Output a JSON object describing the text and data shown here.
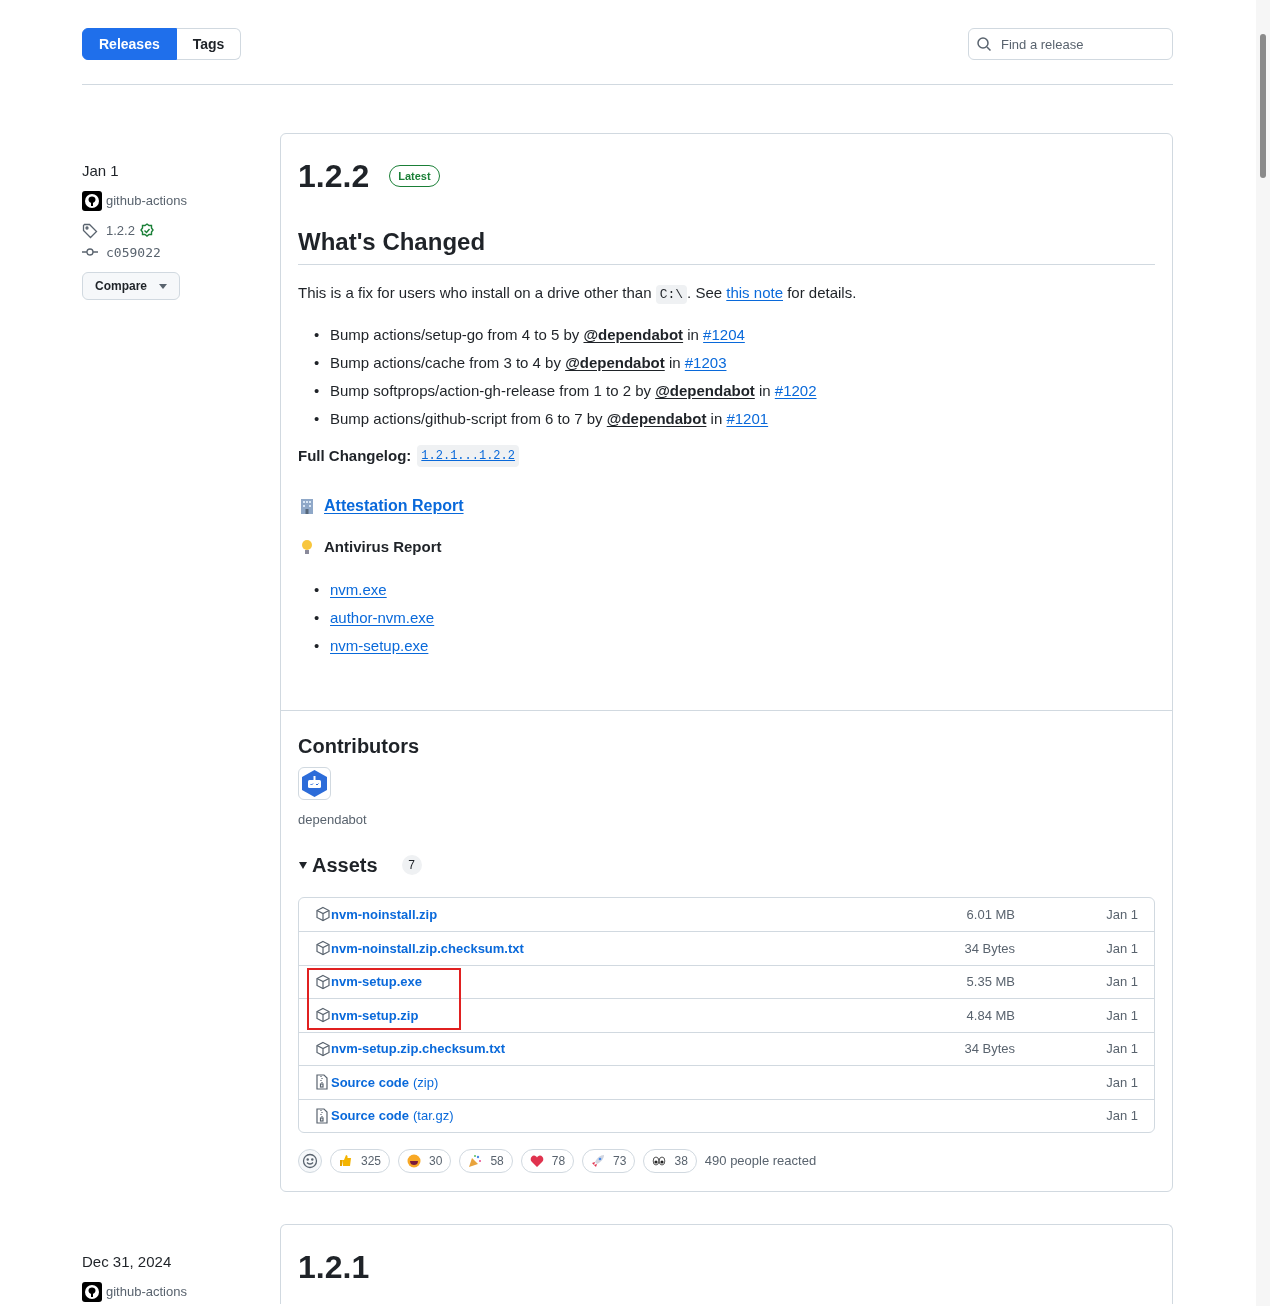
{
  "tabs": [
    {
      "label": "Releases",
      "selected": true
    },
    {
      "label": "Tags",
      "selected": false
    }
  ],
  "search": {
    "placeholder": "Find a release"
  },
  "releases": [
    {
      "date": "Jan 1",
      "author": "github-actions",
      "tag": "1.2.2",
      "verified": true,
      "commit": "c059022",
      "compare": "Compare",
      "title": "1.2.2",
      "latest": true,
      "latest_label": "Latest",
      "heading": "What's Changed",
      "intro": {
        "before": "This is a fix for users who install on a drive other than",
        "code": "C:\\",
        "middle": ". See",
        "link": "this note",
        "after": "for details."
      },
      "changes": [
        {
          "marker": "•",
          "text": "Bump actions/setup-go from 4 to 5 by",
          "user": "@dependabot",
          "in": "in",
          "pr": "#1204"
        },
        {
          "marker": "•",
          "text": "Bump actions/cache from 3 to 4 by",
          "user": "@dependabot",
          "in": "in",
          "pr": "#1203"
        },
        {
          "marker": "•",
          "text": "Bump softprops/action-gh-release from 1 to 2 by",
          "user": "@dependabot",
          "in": "in",
          "pr": "#1202"
        },
        {
          "marker": "•",
          "text": "Bump actions/github-script from 6 to 7 by",
          "user": "@dependabot",
          "in": "in",
          "pr": "#1201"
        }
      ],
      "changelog": {
        "label": "Full Changelog:",
        "link": "1.2.1...1.2.2"
      },
      "attestation": "Attestation Report",
      "antivirus": "Antivirus Report",
      "antivirus_links": [
        {
          "marker": "•",
          "text": "nvm.exe"
        },
        {
          "marker": "•",
          "text": "author-nvm.exe"
        },
        {
          "marker": "•",
          "text": "nvm-setup.exe"
        }
      ],
      "contributors_heading": "Contributors",
      "contributors": [
        "dependabot"
      ],
      "assets_heading": "Assets",
      "assets_count": "7",
      "assets_expanded": true,
      "assets": [
        {
          "kind": "file",
          "name": "nvm-noinstall.zip",
          "size": "6.01 MB",
          "date": "Jan 1",
          "marked": false
        },
        {
          "kind": "file",
          "name": "nvm-noinstall.zip.checksum.txt",
          "size": "34 Bytes",
          "date": "Jan 1",
          "marked": false
        },
        {
          "kind": "file",
          "name": "nvm-setup.exe",
          "size": "5.35 MB",
          "date": "Jan 1",
          "marked": true
        },
        {
          "kind": "file",
          "name": "nvm-setup.zip",
          "size": "4.84 MB",
          "date": "Jan 1",
          "marked": true
        },
        {
          "kind": "file",
          "name": "nvm-setup.zip.checksum.txt",
          "size": "34 Bytes",
          "date": "Jan 1",
          "marked": false
        },
        {
          "kind": "source",
          "name": "Source code",
          "format": "(zip)",
          "date": "Jan 1",
          "marked": false
        },
        {
          "kind": "source",
          "name": "Source code",
          "format": "(tar.gz)",
          "date": "Jan 1",
          "marked": false
        }
      ],
      "reactions": [
        {
          "kind": "thumbs",
          "count": "325"
        },
        {
          "kind": "laugh",
          "count": "30"
        },
        {
          "kind": "hooray",
          "count": "58"
        },
        {
          "kind": "heart",
          "count": "78"
        },
        {
          "kind": "rocket",
          "count": "73"
        },
        {
          "kind": "eyes",
          "count": "38"
        }
      ],
      "reacted": "490 people reacted"
    },
    {
      "date": "Dec 31, 2024",
      "author": "github-actions",
      "title": "1.2.1"
    }
  ]
}
